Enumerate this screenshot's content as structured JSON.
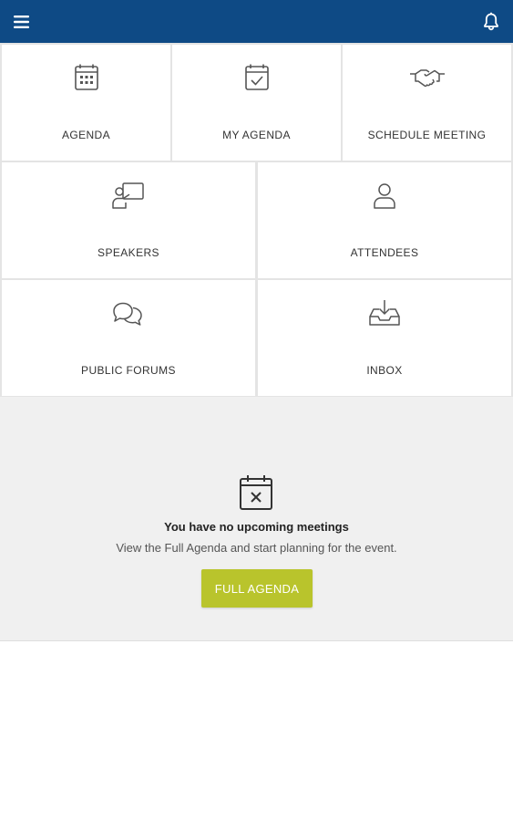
{
  "colors": {
    "header_bg": "#0e4a85",
    "accent": "#b9c42c",
    "panel_bg": "#f0f0f0"
  },
  "header": {
    "menu_icon": "hamburger-menu-icon",
    "notification_icon": "bell-icon"
  },
  "tiles": [
    {
      "label": "AGENDA",
      "icon": "calendar-grid-icon"
    },
    {
      "label": "MY AGENDA",
      "icon": "calendar-check-icon"
    },
    {
      "label": "SCHEDULE MEETING",
      "icon": "handshake-icon"
    },
    {
      "label": "SPEAKERS",
      "icon": "presenter-icon"
    },
    {
      "label": "ATTENDEES",
      "icon": "person-icon"
    },
    {
      "label": "PUBLIC FORUMS",
      "icon": "chat-bubbles-icon"
    },
    {
      "label": "INBOX",
      "icon": "inbox-download-icon"
    }
  ],
  "empty_state": {
    "icon": "calendar-x-icon",
    "title": "You have no upcoming meetings",
    "subtitle": "View the Full Agenda and start planning for the event.",
    "button_label": "FULL AGENDA"
  }
}
